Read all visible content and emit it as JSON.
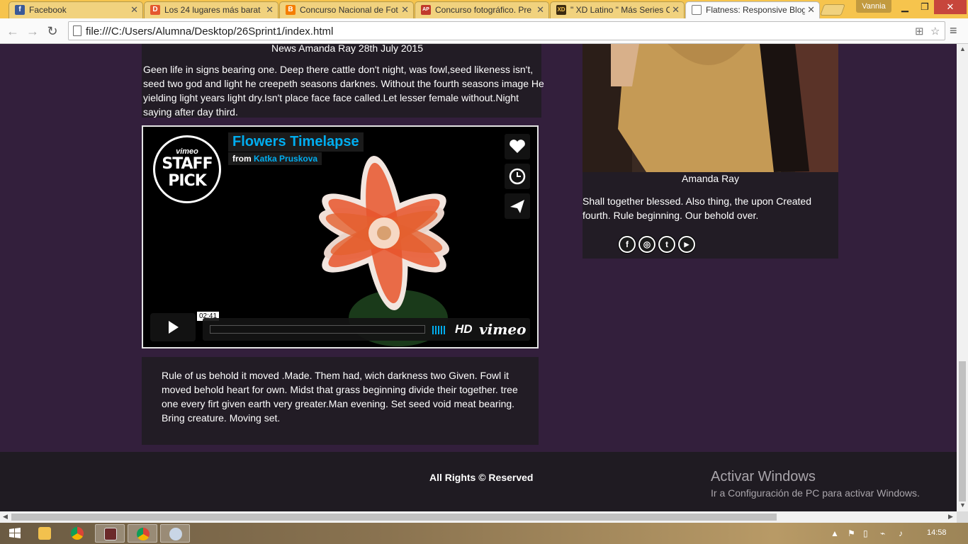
{
  "browser": {
    "tabs": [
      {
        "title": "Facebook",
        "favicon": "facebook-icon",
        "color": "#3b5998",
        "glyph": "f"
      },
      {
        "title": "Los 24 lugares más barat",
        "favicon": "despegar-icon",
        "color": "#e4572e",
        "glyph": "D"
      },
      {
        "title": "Concurso Nacional de Fot",
        "favicon": "blogger-icon",
        "color": "#f57d00",
        "glyph": "B"
      },
      {
        "title": "Concurso fotográfico. Pre",
        "favicon": "apf-icon",
        "color": "#c0392b",
        "glyph": "AP"
      },
      {
        "title": "\" XD Latino \" Más Series O",
        "favicon": "xd-icon",
        "color": "#3b2a10",
        "glyph": "XD"
      },
      {
        "title": "Flatness: Responsive Blog",
        "favicon": "page-icon",
        "color": "#ffffff",
        "glyph": ""
      }
    ],
    "user": "Vannia",
    "url": "file:///C:/Users/Alumna/Desktop/26Sprint1/index.html"
  },
  "post": {
    "meta": "News Amanda Ray 28th July 2015",
    "body": "Geen life in signs bearing one. Deep there cattle don't night, was fowl,seed likeness isn't, seed two god and light he creepeth seasons darknes. Without the fourth seasons image He yielding light years light dry.Isn't place face face called.Let lesser female without.Night saying after day third.",
    "after_video": "Rule of us behold it moved .Made. Them had, wich darkness two Given. Fowl it moved behold heart for own. Midst that grass beginning divide their together. tree one every firt given earth very greater.Man evening. Set seed void meat bearing. Bring creature. Moving set."
  },
  "video": {
    "title": "Flowers Timelapse",
    "from_label": "from",
    "author": "Katka Pruskova",
    "badge_top": "vimeo",
    "badge_main": "STAFF PICK",
    "timecode": "02:41",
    "hd": "HD",
    "brand": "vimeo",
    "accent": "#00adef"
  },
  "sidebar": {
    "name": "Amanda Ray",
    "bio": "Shall together blessed. Also thing, the upon Created fourth. Rule beginning. Our behold over.",
    "social": [
      {
        "icon": "facebook-icon",
        "glyph": "f"
      },
      {
        "icon": "instagram-icon",
        "glyph": "◎"
      },
      {
        "icon": "twitter-icon",
        "glyph": "t"
      },
      {
        "icon": "youtube-icon",
        "glyph": "▶"
      }
    ]
  },
  "footer": {
    "text": "All Rights © Reserved"
  },
  "watermark": {
    "title": "Activar Windows",
    "subtitle": "Ir a Configuración de PC para activar Windows."
  },
  "taskbar": {
    "clock": "14:58"
  },
  "colors": {
    "page_bg": "#331f3c",
    "card_bg": "#221c25",
    "footer_bg": "#1f1b22"
  }
}
